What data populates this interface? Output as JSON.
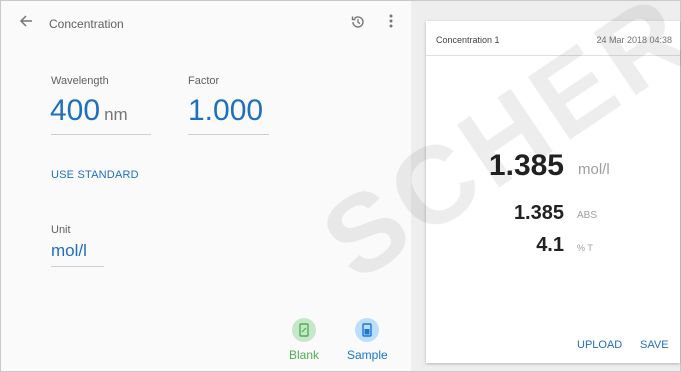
{
  "header": {
    "title": "Concentration"
  },
  "settings": {
    "wavelength_label": "Wavelength",
    "wavelength_value": "400",
    "wavelength_unit": "nm",
    "factor_label": "Factor",
    "factor_value": "1.000",
    "use_standard": "USE STANDARD",
    "unit_label": "Unit",
    "unit_value": "mol/l"
  },
  "actions": {
    "blank_label": "Blank",
    "sample_label": "Sample",
    "blank_color": "#4caf50",
    "sample_color": "#1976d2"
  },
  "result_card": {
    "title": "Concentration 1",
    "date": "24 Mar 2018 04:38",
    "concentration_value": "1.385",
    "concentration_unit": "mol/l",
    "abs_value": "1.385",
    "abs_unit": "ABS",
    "transmission_value": "4.1",
    "transmission_unit": "% T",
    "upload_label": "UPLOAD",
    "save_label": "SAVE"
  },
  "watermark": {
    "text": "SCHER"
  },
  "colors": {
    "accent": "#1f6fbf",
    "background": "#fafafa"
  }
}
